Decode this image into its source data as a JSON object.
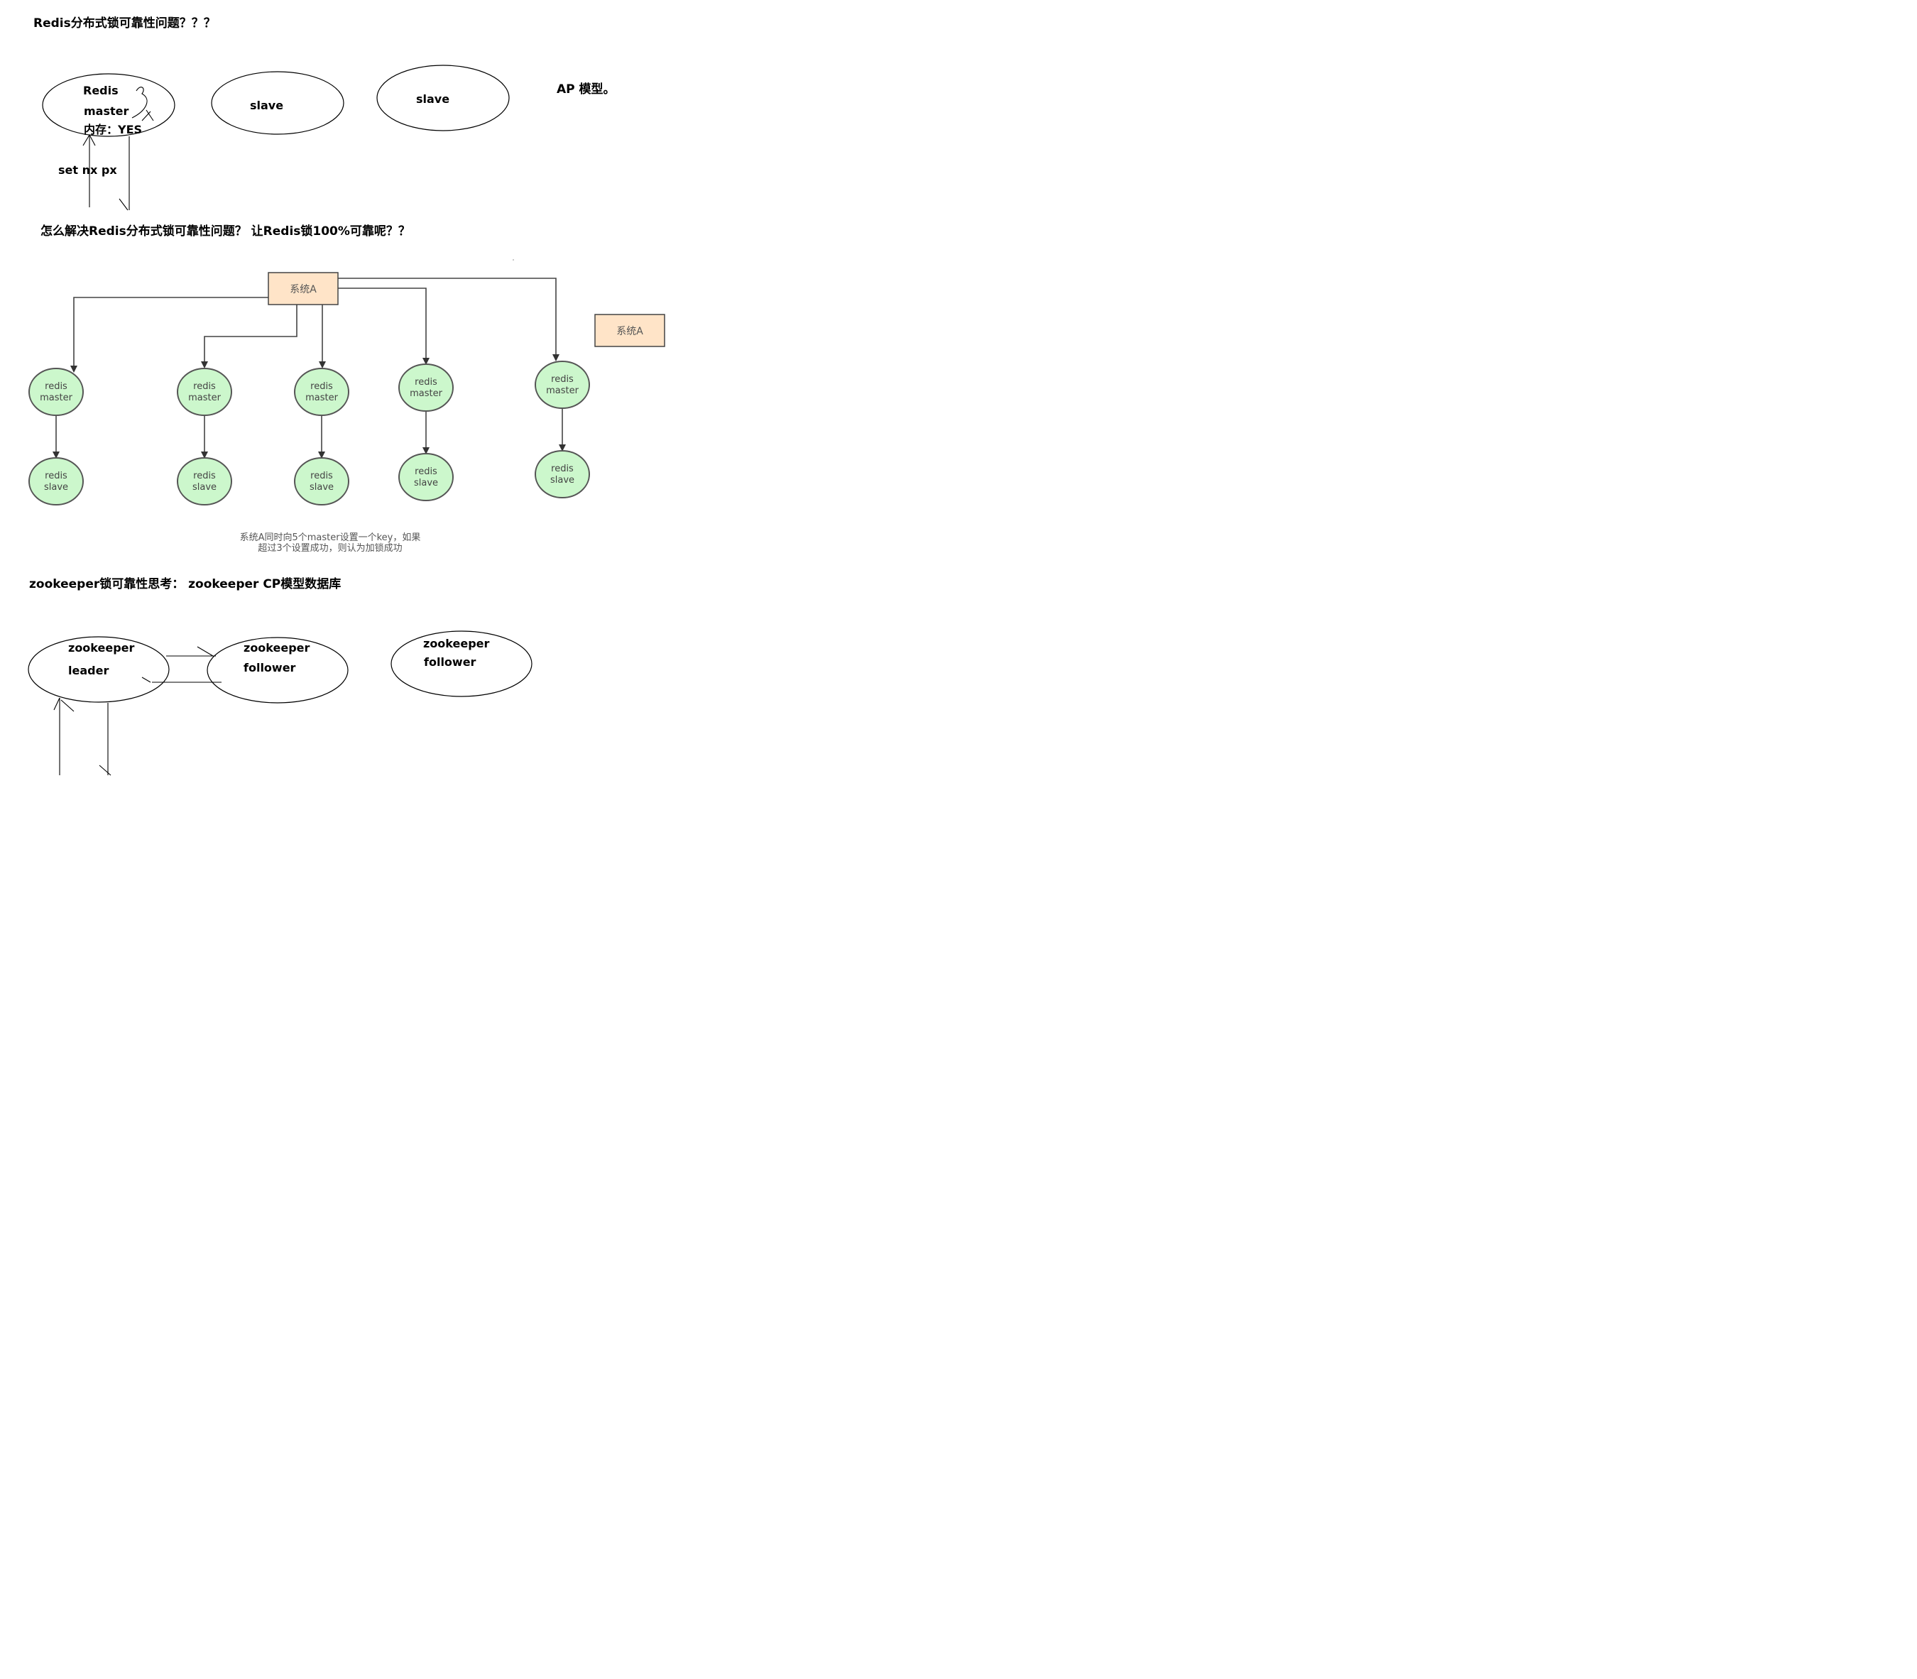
{
  "section1": {
    "title": "Redis分布式锁可靠性问题？？？",
    "master_line1": "Redis",
    "master_line2": "master",
    "master_line3": "内存：YES",
    "slave1": "slave",
    "slave2": "slave",
    "ap_note": "AP 模型。",
    "cmd": "set nx px"
  },
  "section2": {
    "title": "怎么解决Redis分布式锁可靠性问题？ 让Redis锁100%可靠呢？？",
    "system_box": "系统A",
    "system_box_alt": "系统A",
    "node_master_l1": "redis",
    "node_master_l2": "master",
    "node_slave_l1": "redis",
    "node_slave_l2": "slave",
    "caption_line1": "系统A同时向5个master设置一个key，如果",
    "caption_line2": "超过3个设置成功，则认为加锁成功"
  },
  "section3": {
    "title": "zookeeper锁可靠性思考： zookeeper CP模型数据库",
    "leader_l1": "zookeeper",
    "leader_l2": "leader",
    "follower1_l1": "zookeeper",
    "follower1_l2": "follower",
    "follower2_l1": "zookeeper",
    "follower2_l2": "follower"
  },
  "colors": {
    "system_box_fill": "#ffe4c8",
    "node_fill": "#ccf7cc",
    "node_stroke": "#555555",
    "ink": "#000000"
  }
}
